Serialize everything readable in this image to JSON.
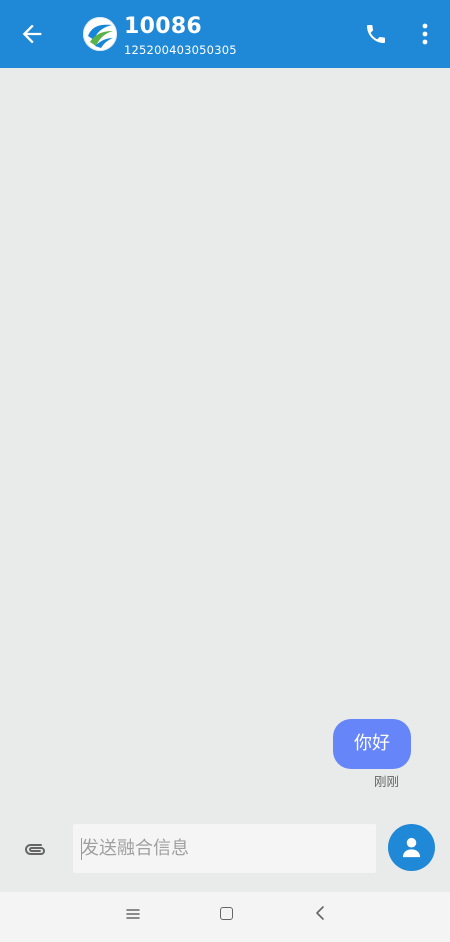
{
  "header": {
    "title": "10086",
    "subtitle": "125200403050305",
    "icons": {
      "back": "arrow-left-icon",
      "logo": "china-mobile-logo-icon",
      "call": "phone-icon",
      "more": "more-vert-icon"
    },
    "color": "#1f88d7"
  },
  "messages": [
    {
      "text": "你好",
      "direction": "outgoing",
      "time": "刚刚",
      "bubble_color": "#6685f8"
    }
  ],
  "composer": {
    "placeholder": "发送融合信息",
    "value": "",
    "icons": {
      "attach": "paperclip-icon",
      "contact": "person-icon"
    }
  },
  "navbar": {
    "icons": [
      "menu-icon",
      "home-square-icon",
      "back-chevron-icon"
    ]
  }
}
